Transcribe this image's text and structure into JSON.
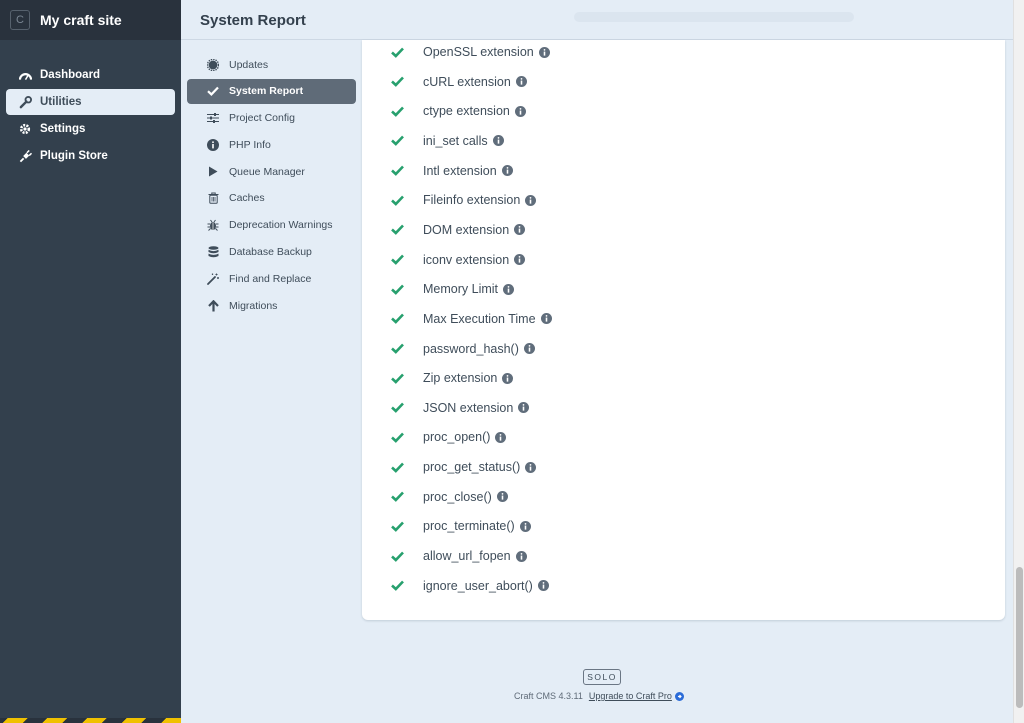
{
  "site": {
    "logo_letter": "C",
    "name": "My craft site"
  },
  "global_nav": [
    {
      "label": "Dashboard",
      "icon": "dashboard-icon"
    },
    {
      "label": "Utilities",
      "icon": "wrench-icon",
      "active": true
    },
    {
      "label": "Settings",
      "icon": "gear-icon"
    },
    {
      "label": "Plugin Store",
      "icon": "plug-icon"
    }
  ],
  "header": {
    "title": "System Report"
  },
  "utilities_nav": [
    {
      "label": "Updates",
      "icon": "badge-icon"
    },
    {
      "label": "System Report",
      "icon": "check-icon",
      "active": true
    },
    {
      "label": "Project Config",
      "icon": "sliders-icon"
    },
    {
      "label": "PHP Info",
      "icon": "info-icon"
    },
    {
      "label": "Queue Manager",
      "icon": "play-icon"
    },
    {
      "label": "Caches",
      "icon": "trash-icon"
    },
    {
      "label": "Deprecation Warnings",
      "icon": "bug-icon"
    },
    {
      "label": "Database Backup",
      "icon": "database-icon"
    },
    {
      "label": "Find and Replace",
      "icon": "magic-wand-icon"
    },
    {
      "label": "Migrations",
      "icon": "arrow-up-icon"
    }
  ],
  "requirements": [
    "OpenSSL extension",
    "cURL extension",
    "ctype extension",
    "ini_set calls",
    "Intl extension",
    "Fileinfo extension",
    "DOM extension",
    "iconv extension",
    "Memory Limit",
    "Max Execution Time",
    "password_hash()",
    "Zip extension",
    "JSON extension",
    "proc_open()",
    "proc_get_status()",
    "proc_close()",
    "proc_terminate()",
    "allow_url_fopen",
    "ignore_user_abort()"
  ],
  "footer": {
    "edition": "SOLO",
    "version": "Craft CMS 4.3.11",
    "upgrade_link": "Upgrade to Craft Pro"
  },
  "colors": {
    "sidebar": "#33404d",
    "accent_green": "#27a06e",
    "background": "#e4edf6"
  }
}
